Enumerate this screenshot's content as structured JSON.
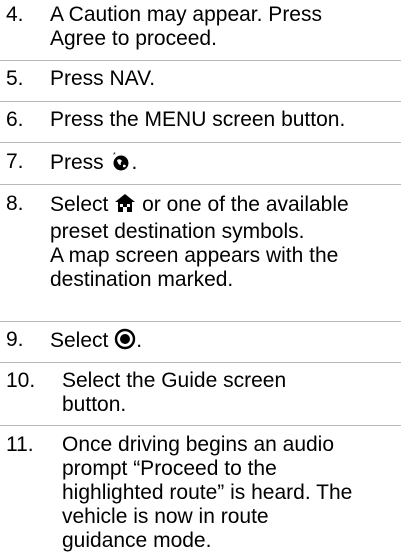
{
  "steps": [
    {
      "number": "4.",
      "lines": [
        "A Caution may appear. Press",
        "Agree to proceed."
      ]
    },
    {
      "number": "5.",
      "lines": [
        "Press NAV."
      ]
    },
    {
      "number": "6.",
      "lines": [
        "Press the MENU screen button."
      ]
    },
    {
      "number": "7.",
      "lines": [
        "Press",
        "."
      ],
      "icon": "destination-globe-icon"
    },
    {
      "number": "8.",
      "lines": [
        "Select",
        "or one of the available",
        "preset destination symbols.",
        "A map screen appears with the",
        "destination marked."
      ],
      "icon": "home-icon"
    },
    {
      "number": "9.",
      "lines": [
        "Select",
        "."
      ],
      "icon": "go-target-icon"
    },
    {
      "number": "10.",
      "lines": [
        "Select the Guide screen",
        "button."
      ]
    },
    {
      "number": "11.",
      "lines": [
        "Once driving begins an audio",
        "prompt “Proceed to the",
        "highlighted route” is heard. The",
        "vehicle is now in route",
        "guidance mode."
      ]
    }
  ]
}
